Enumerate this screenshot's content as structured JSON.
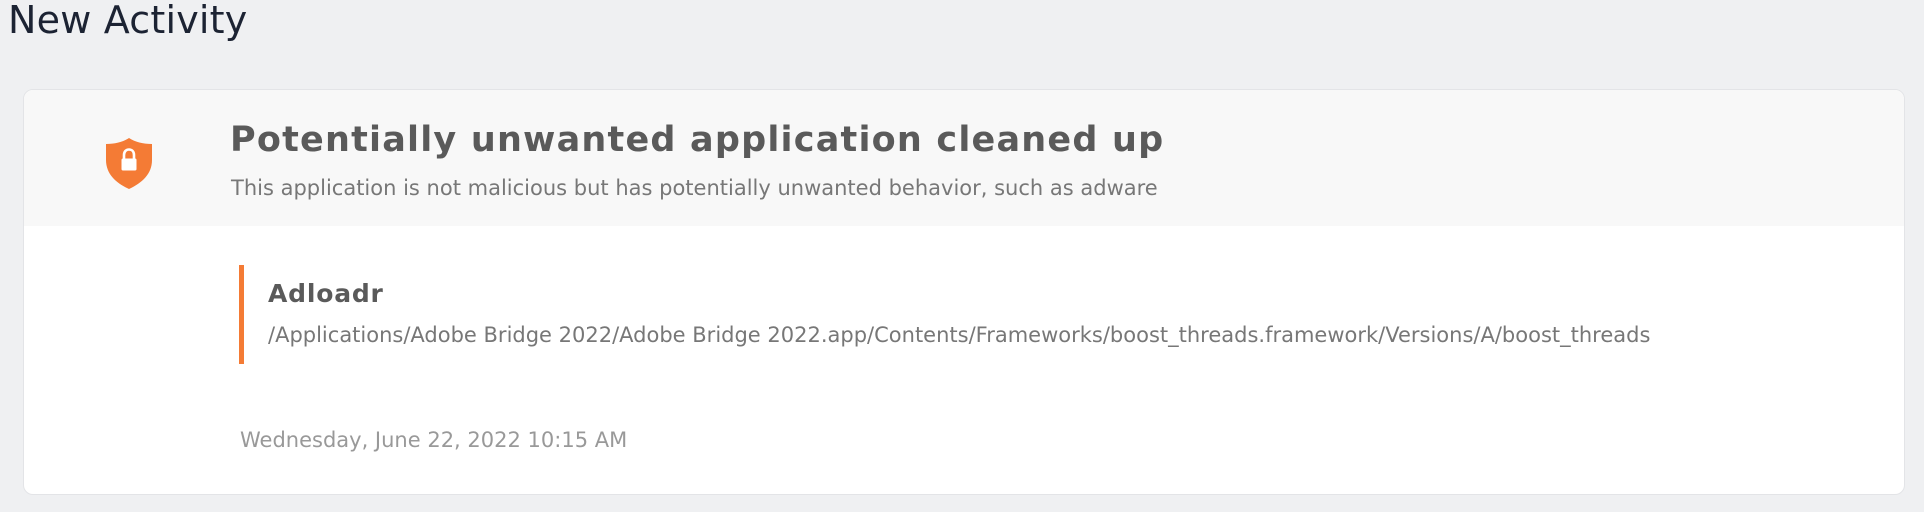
{
  "page": {
    "title": "New Activity"
  },
  "activity": {
    "title": "Potentially unwanted application cleaned up",
    "subtitle": "This application is not malicious but has potentially unwanted behavior, such as adware",
    "icon": "shield-lock-icon",
    "accent_color": "#f47b35",
    "detection": {
      "name": "Adloadr",
      "path": "/Applications/Adobe Bridge 2022/Adobe Bridge 2022.app/Contents/Frameworks/boost_threads.framework/Versions/A/boost_threads"
    },
    "timestamp": "Wednesday, June 22, 2022 10:15 AM"
  }
}
